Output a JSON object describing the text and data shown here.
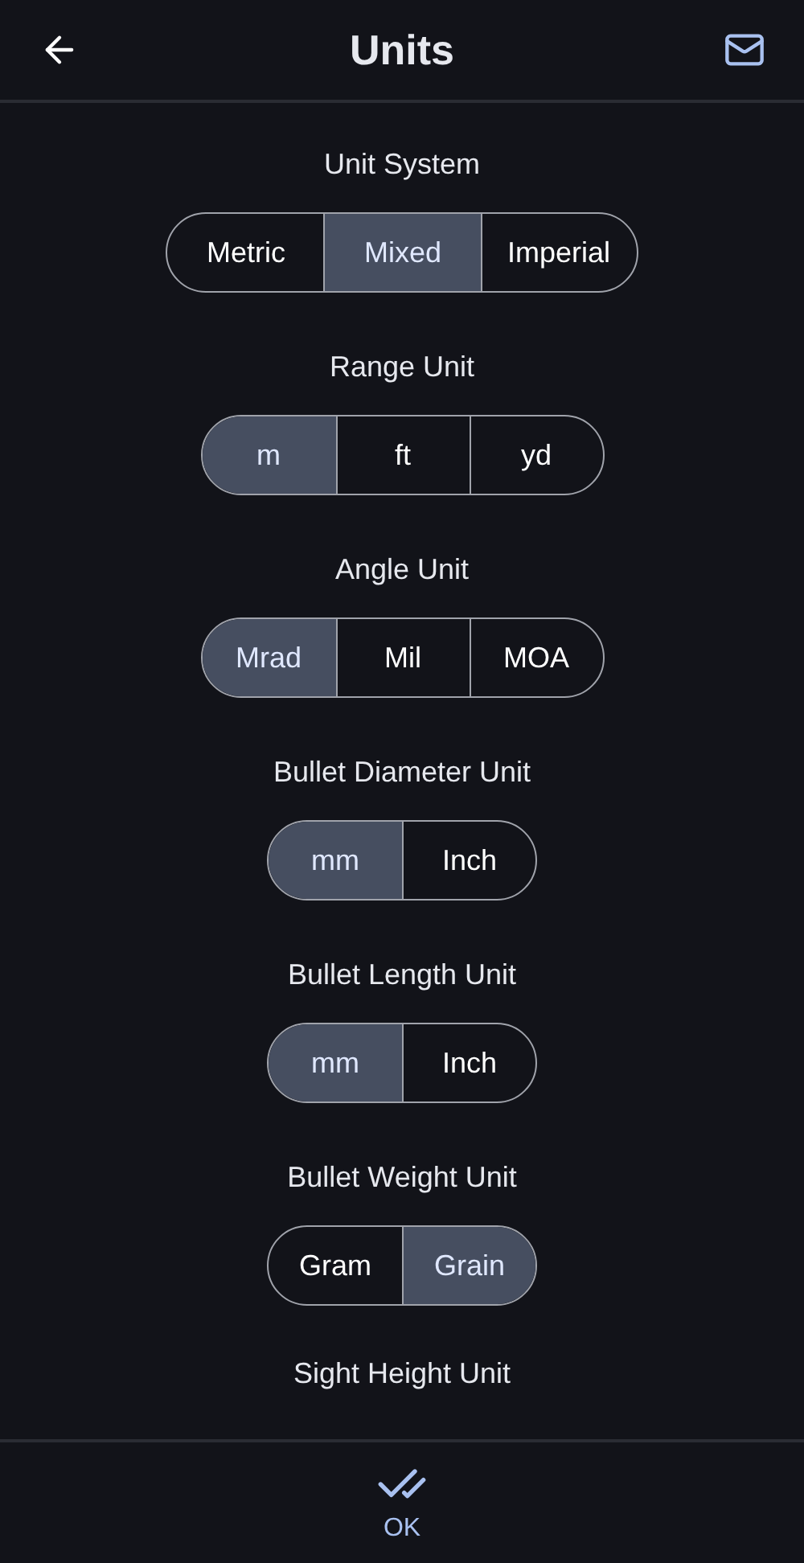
{
  "header": {
    "title": "Units"
  },
  "groups": [
    {
      "label": "Unit System",
      "options": [
        {
          "label": "Metric",
          "selected": false
        },
        {
          "label": "Mixed",
          "selected": true
        },
        {
          "label": "Imperial",
          "selected": false
        }
      ]
    },
    {
      "label": "Range Unit",
      "options": [
        {
          "label": "m",
          "selected": true
        },
        {
          "label": "ft",
          "selected": false
        },
        {
          "label": "yd",
          "selected": false
        }
      ]
    },
    {
      "label": "Angle Unit",
      "options": [
        {
          "label": "Mrad",
          "selected": true
        },
        {
          "label": "Mil",
          "selected": false
        },
        {
          "label": "MOA",
          "selected": false
        }
      ]
    },
    {
      "label": "Bullet Diameter Unit",
      "options": [
        {
          "label": "mm",
          "selected": true
        },
        {
          "label": "Inch",
          "selected": false
        }
      ]
    },
    {
      "label": "Bullet Length Unit",
      "options": [
        {
          "label": "mm",
          "selected": true
        },
        {
          "label": "Inch",
          "selected": false
        }
      ]
    },
    {
      "label": "Bullet Weight Unit",
      "options": [
        {
          "label": "Gram",
          "selected": false
        },
        {
          "label": "Grain",
          "selected": true
        }
      ]
    }
  ],
  "trailing_label": "Sight Height Unit",
  "footer": {
    "button": "OK"
  }
}
